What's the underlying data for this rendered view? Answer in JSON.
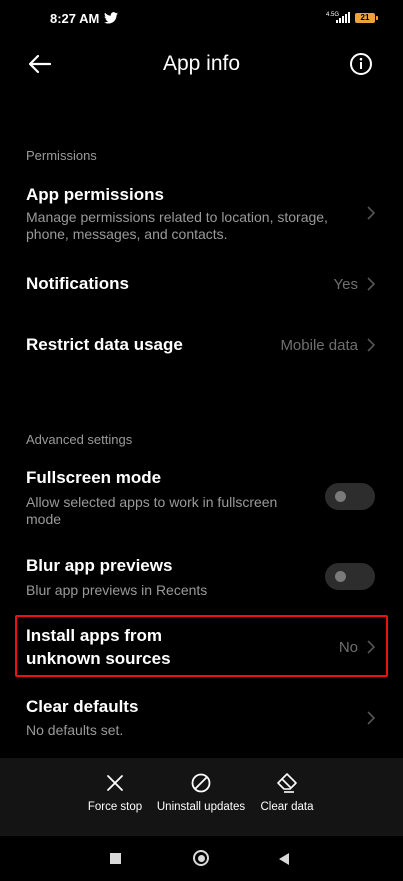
{
  "status_bar": {
    "time": "8:27 AM",
    "network_label": "4.5G",
    "battery_level": "21"
  },
  "header": {
    "title": "App info"
  },
  "permissions": {
    "section_label": "Permissions",
    "app_permissions": {
      "title": "App permissions",
      "subtitle": "Manage permissions related to location, storage, phone, messages, and contacts."
    },
    "notifications": {
      "title": "Notifications",
      "value": "Yes"
    },
    "restrict_data": {
      "title": "Restrict data usage",
      "value": "Mobile data"
    }
  },
  "advanced": {
    "section_label": "Advanced settings",
    "fullscreen": {
      "title": "Fullscreen mode",
      "subtitle": "Allow selected apps to work in fullscreen mode",
      "enabled": false
    },
    "blur": {
      "title": "Blur app previews",
      "subtitle": "Blur app previews in Recents",
      "enabled": false
    },
    "unknown_sources": {
      "title_line1": "Install apps from",
      "title_line2": "unknown sources",
      "value": "No"
    },
    "clear_defaults": {
      "title": "Clear defaults",
      "subtitle": "No defaults set."
    }
  },
  "actions": {
    "force_stop": "Force stop",
    "uninstall_updates": "Uninstall updates",
    "clear_data": "Clear data"
  },
  "colors": {
    "highlight": "#ee1111",
    "battery": "#f0a23a"
  }
}
